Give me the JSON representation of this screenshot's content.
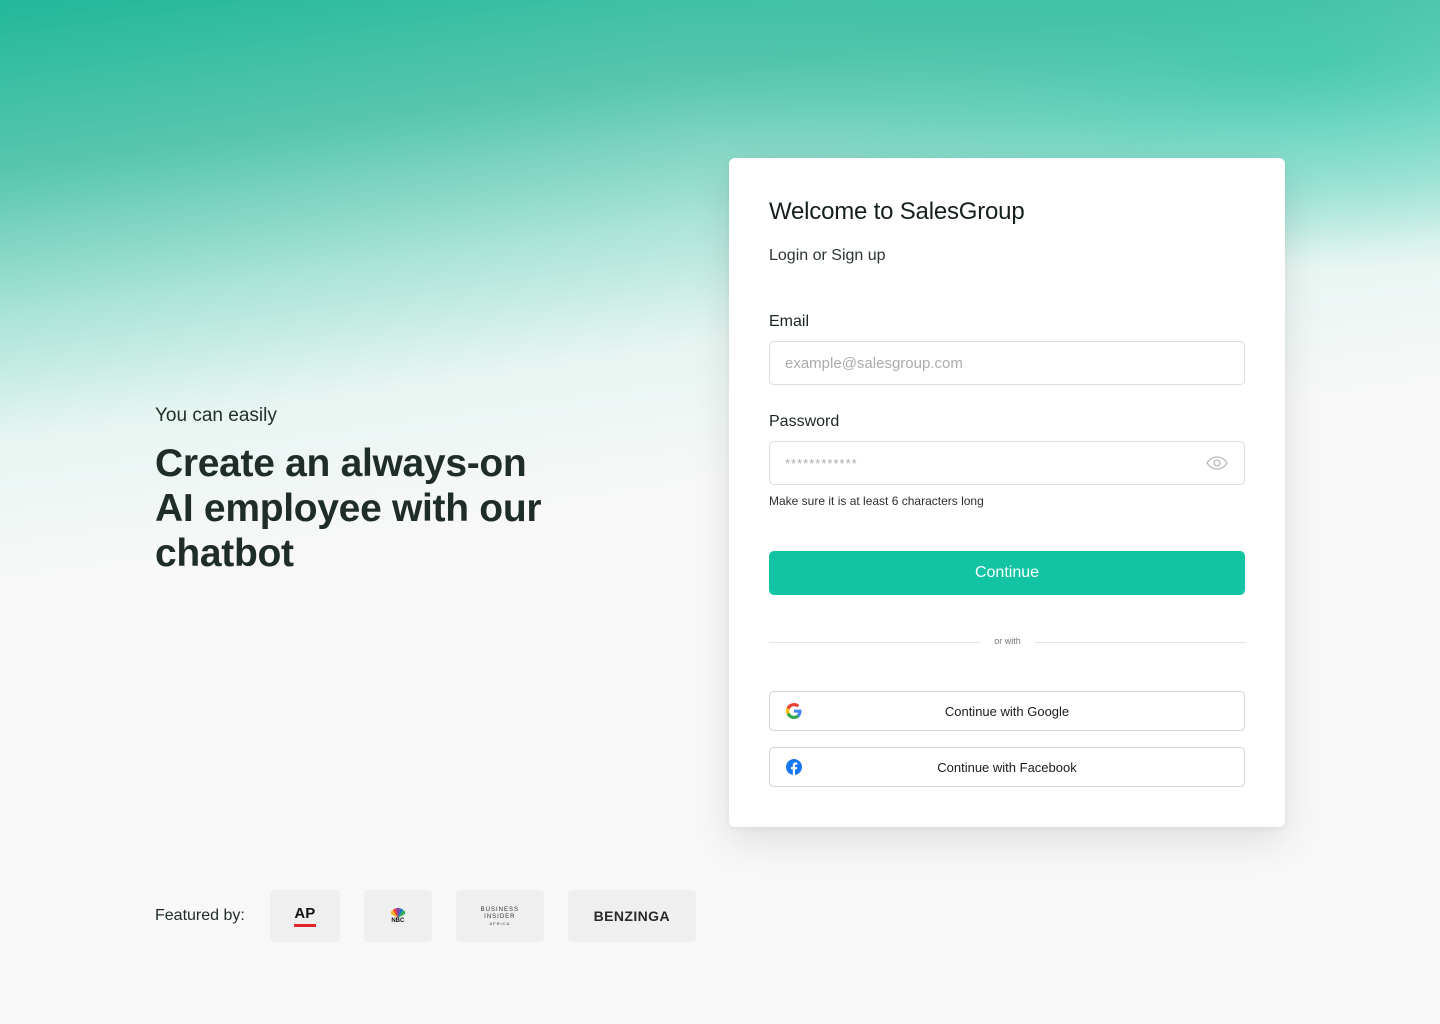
{
  "hero": {
    "kicker": "You can easily",
    "title_line1": "Create an always-on",
    "title_line2": "AI employee with our",
    "title_line3": "chatbot"
  },
  "featured": {
    "label": "Featured by:",
    "logos": [
      {
        "name": "AP",
        "text": "AP"
      },
      {
        "name": "NBC",
        "text": "NBC"
      },
      {
        "name": "Business Insider Africa",
        "line1": "BUSINESS",
        "line2": "INSIDER",
        "line3": "AFRICA"
      },
      {
        "name": "Benzinga",
        "text": "BENZINGA"
      }
    ]
  },
  "card": {
    "title": "Welcome to SalesGroup",
    "subtitle": "Login or Sign up",
    "email": {
      "label": "Email",
      "placeholder": "example@salesgroup.com",
      "value": ""
    },
    "password": {
      "label": "Password",
      "placeholder": "************",
      "value": "",
      "hint": "Make sure it is at least 6 characters long",
      "toggle_icon": "eye-icon"
    },
    "continue_label": "Continue",
    "divider_label": "or with",
    "google_label": "Continue with Google",
    "facebook_label": "Continue with Facebook"
  },
  "colors": {
    "accent": "#12c4a4",
    "facebook": "#1877f2",
    "ap_red": "#e0262c"
  }
}
